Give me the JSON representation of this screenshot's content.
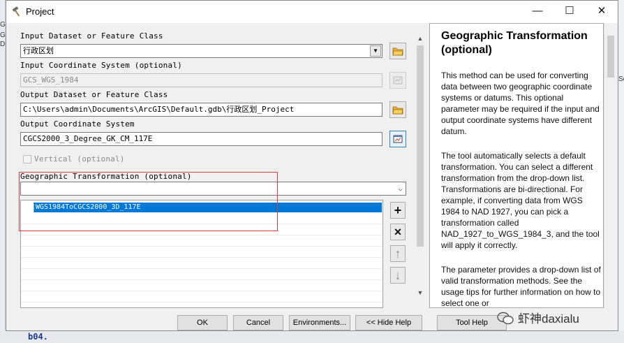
{
  "window": {
    "title": "Project",
    "minimize_glyph": "—",
    "maximize_glyph": "☐",
    "close_glyph": "✕"
  },
  "background": {
    "left_fragments": [
      "G",
      "G",
      "D,"
    ],
    "right_fragment": "Se",
    "bottom_code": "b04."
  },
  "form": {
    "input_dataset_label": "Input Dataset or Feature Class",
    "input_dataset_value": "行政区划",
    "input_cs_label": "Input Coordinate System (optional)",
    "input_cs_value": "GCS_WGS_1984",
    "output_dataset_label": "Output Dataset or Feature Class",
    "output_dataset_value": "C:\\Users\\admin\\Documents\\ArcGIS\\Default.gdb\\行政区划_Project",
    "output_cs_label": "Output Coordinate System",
    "output_cs_value": "CGCS2000_3_Degree_GK_CM_117E",
    "vertical_label": "Vertical (optional)",
    "geo_transform_label": "Geographic Transformation (optional)",
    "geo_transform_value": "",
    "transform_list": [
      "WGS1984ToCGCS2000_3D_117E"
    ]
  },
  "side_buttons": {
    "add": "+",
    "remove": "×",
    "up": "↑",
    "down": "↓"
  },
  "help": {
    "heading": "Geographic Transformation (optional)",
    "paragraphs": [
      "This method can be used for converting data between two geographic coordinate systems or datums. This optional parameter may be required if the input and output coordinate systems have different datum.",
      "The tool automatically selects a default transformation. You can select a different transformation from the drop-down list. Transformations are bi-directional. For example, if converting data from WGS 1984 to NAD 1927, you can pick a transformation called NAD_1927_to_WGS_1984_3, and the tool will apply it correctly.",
      "The parameter provides a drop-down list of valid transformation methods. See the usage tips for further information on how to select one or"
    ]
  },
  "buttons": {
    "ok": "OK",
    "cancel": "Cancel",
    "environments": "Environments...",
    "hide_help": "<< Hide Help",
    "tool_help": "Tool Help"
  },
  "watermark": "虾神daxialu",
  "colors": {
    "selection": "#0078d7",
    "highlight_box": "#e0393e",
    "folder_icon": "#e8b23a"
  }
}
